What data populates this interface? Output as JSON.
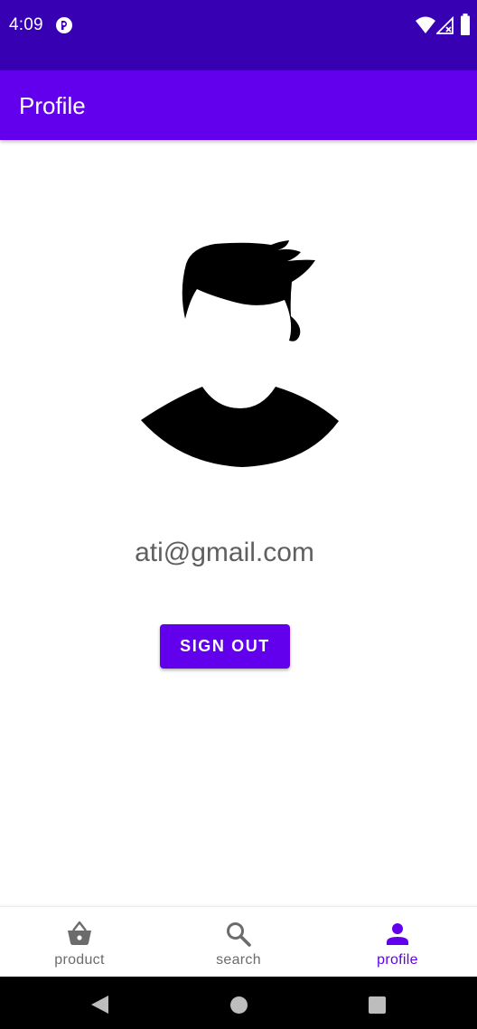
{
  "status_bar": {
    "time": "4:09",
    "background": "#3700b3",
    "icons": [
      "app-notification-icon",
      "wifi-icon",
      "signal-icon",
      "battery-icon"
    ]
  },
  "app_bar": {
    "title": "Profile",
    "background": "#6200ee"
  },
  "profile": {
    "avatar_icon": "user-avatar-icon",
    "email": "ati@gmail.com",
    "sign_out_label": "SIGN OUT"
  },
  "bottom_nav": {
    "items": [
      {
        "label": "product",
        "icon": "basket-icon",
        "active": false
      },
      {
        "label": "search",
        "icon": "search-icon",
        "active": false
      },
      {
        "label": "profile",
        "icon": "person-icon",
        "active": true
      }
    ],
    "active_color": "#6200ee",
    "inactive_color": "#6b6b6b"
  },
  "system_nav": {
    "buttons": [
      "back-icon",
      "home-icon",
      "recents-icon"
    ]
  }
}
